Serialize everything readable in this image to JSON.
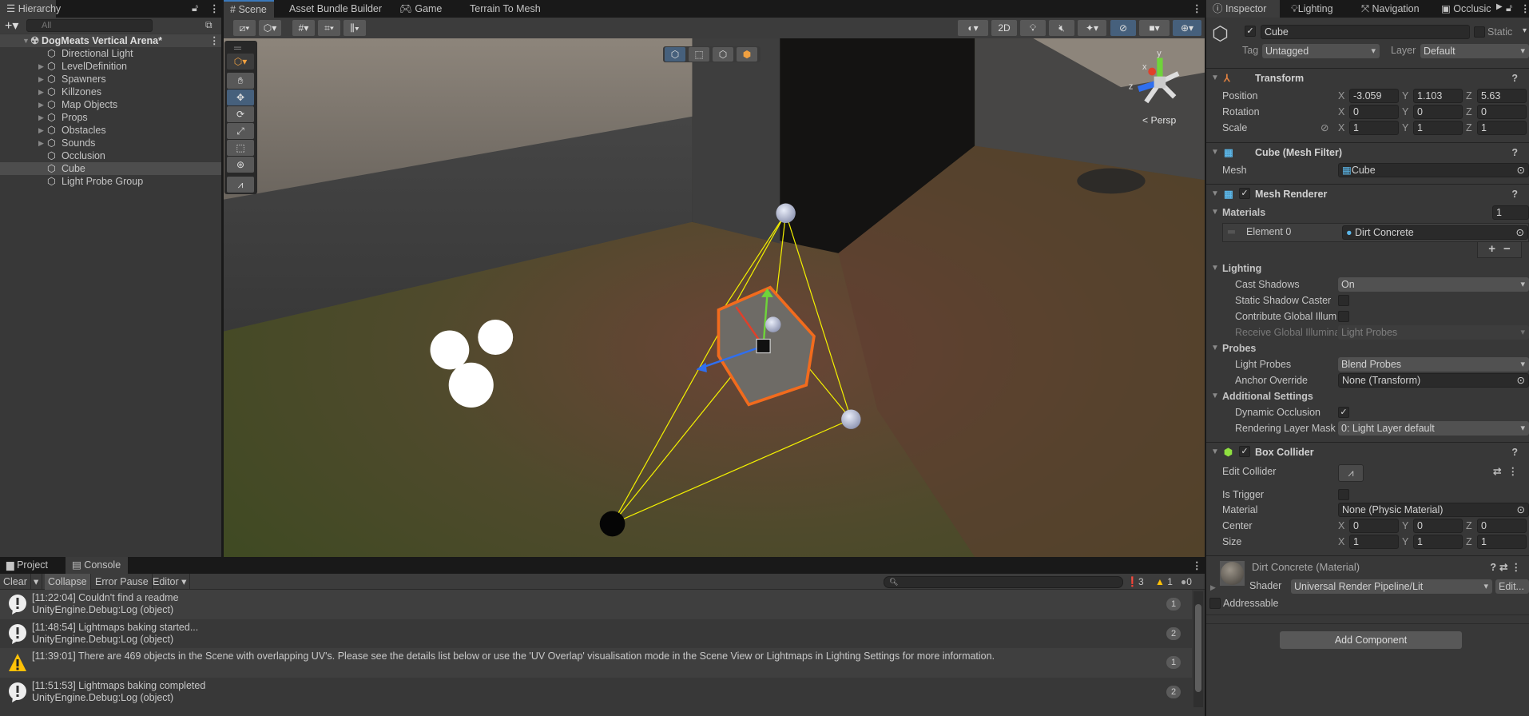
{
  "hierarchy": {
    "tab_label": "Hierarchy",
    "search_placeholder": "All",
    "scene_name": "DogMeats Vertical Arena*",
    "items": [
      {
        "label": "Directional Light",
        "expandable": false
      },
      {
        "label": "LevelDefinition",
        "expandable": true
      },
      {
        "label": "Spawners",
        "expandable": true
      },
      {
        "label": "Killzones",
        "expandable": true
      },
      {
        "label": "Map Objects",
        "expandable": true
      },
      {
        "label": "Props",
        "expandable": true
      },
      {
        "label": "Obstacles",
        "expandable": true
      },
      {
        "label": "Sounds",
        "expandable": true
      },
      {
        "label": "Occlusion",
        "expandable": false
      },
      {
        "label": "Cube",
        "expandable": false,
        "selected": true
      },
      {
        "label": "Light Probe Group",
        "expandable": false
      }
    ]
  },
  "scene_tabs": [
    "Scene",
    "Asset Bundle Builder",
    "Game",
    "Terrain To Mesh"
  ],
  "scene_toolbar": {
    "mode_2d": "2D",
    "projection": "Persp",
    "gizmo_labels": {
      "x": "x",
      "y": "y",
      "z": "z"
    }
  },
  "inspector": {
    "tabs": [
      "Inspector",
      "Lighting",
      "Navigation",
      "Occlusic"
    ],
    "object_name": "Cube",
    "static_label": "Static",
    "active": true,
    "tag_label": "Tag",
    "tag": "Untagged",
    "layer_label": "Layer",
    "layer": "Default",
    "transform": {
      "title": "Transform",
      "position_label": "Position",
      "position": {
        "x": "-3.059",
        "y": "1.103",
        "z": "5.63"
      },
      "rotation_label": "Rotation",
      "rotation": {
        "x": "0",
        "y": "0",
        "z": "0"
      },
      "scale_label": "Scale",
      "scale": {
        "x": "1",
        "y": "1",
        "z": "1"
      }
    },
    "mesh_filter": {
      "title": "Cube (Mesh Filter)",
      "mesh_label": "Mesh",
      "mesh": "Cube"
    },
    "mesh_renderer": {
      "title": "Mesh Renderer",
      "materials_label": "Materials",
      "materials_count": "1",
      "element0_label": "Element 0",
      "element0": "Dirt Concrete",
      "lighting_label": "Lighting",
      "cast_shadows_label": "Cast Shadows",
      "cast_shadows": "On",
      "static_shadow_label": "Static Shadow Caster",
      "contribute_gi_label": "Contribute Global Illum",
      "receive_gi_label": "Receive Global Illumina",
      "receive_gi": "Light Probes",
      "probes_label": "Probes",
      "light_probes_label": "Light Probes",
      "light_probes": "Blend Probes",
      "anchor_label": "Anchor Override",
      "anchor": "None (Transform)",
      "additional_label": "Additional Settings",
      "dynamic_occlusion_label": "Dynamic Occlusion",
      "rendering_layer_label": "Rendering Layer Mask",
      "rendering_layer": "0: Light Layer default"
    },
    "box_collider": {
      "title": "Box Collider",
      "edit_label": "Edit Collider",
      "trigger_label": "Is Trigger",
      "material_label": "Material",
      "material": "None (Physic Material)",
      "center_label": "Center",
      "center": {
        "x": "0",
        "y": "0",
        "z": "0"
      },
      "size_label": "Size",
      "size": {
        "x": "1",
        "y": "1",
        "z": "1"
      }
    },
    "material": {
      "title": "Dirt Concrete (Material)",
      "shader_label": "Shader",
      "shader": "Universal Render Pipeline/Lit",
      "edit_label": "Edit..."
    },
    "addressable_label": "Addressable",
    "add_component": "Add Component"
  },
  "console": {
    "tabs": [
      "Project",
      "Console"
    ],
    "buttons": {
      "clear": "Clear",
      "collapse": "Collapse",
      "error_pause": "Error Pause",
      "editor": "Editor"
    },
    "counts": {
      "log": "3",
      "warning": "1",
      "error": "0"
    },
    "entries": [
      {
        "type": "log",
        "line1": "[11:22:04] Couldn't find a readme",
        "line2": "UnityEngine.Debug:Log (object)",
        "count": "1"
      },
      {
        "type": "log",
        "line1": "[11:48:54] Lightmaps baking started...",
        "line2": "UnityEngine.Debug:Log (object)",
        "count": "2"
      },
      {
        "type": "warning",
        "line1": "[11:39:01] There are 469 objects in the Scene with overlapping UV's. Please see the details list below or use the 'UV Overlap' visualisation mode in the Scene View or Lightmaps in Lighting Settings for more information.",
        "line2": "",
        "count": "1"
      },
      {
        "type": "log",
        "line1": "[11:51:53] Lightmaps baking completed",
        "line2": "UnityEngine.Debug:Log (object)",
        "count": "2"
      }
    ]
  },
  "colors": {
    "accent": "#3a79bb",
    "selection_outline": "#f26b1d",
    "warning": "#ffc107"
  }
}
